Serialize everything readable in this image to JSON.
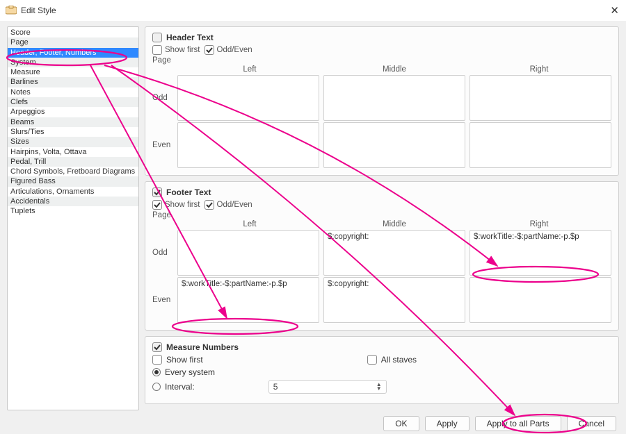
{
  "window": {
    "title": "Edit Style",
    "close_glyph": "✕"
  },
  "sidebar": {
    "items": [
      "Score",
      "Page",
      "Header, Footer, Numbers",
      "System",
      "Measure",
      "Barlines",
      "Notes",
      "Clefs",
      "Arpeggios",
      "Beams",
      "Slurs/Ties",
      "Sizes",
      "Hairpins, Volta, Ottava",
      "Pedal, Trill",
      "Chord Symbols, Fretboard Diagrams",
      "Figured Bass",
      "Articulations, Ornaments",
      "Accidentals",
      "Tuplets"
    ],
    "selected_index": 2
  },
  "header": {
    "title": "Header Text",
    "enabled": false,
    "show_first_label": "Show first",
    "show_first": false,
    "oddeven_label": "Odd/Even",
    "oddeven": true,
    "page_label": "Page",
    "cols": [
      "Left",
      "Middle",
      "Right"
    ],
    "rows": [
      "Odd",
      "Even"
    ],
    "odd": {
      "left": "",
      "middle": "",
      "right": ""
    },
    "even": {
      "left": "",
      "middle": "",
      "right": ""
    }
  },
  "footer": {
    "title": "Footer Text",
    "enabled": true,
    "show_first_label": "Show first",
    "show_first": true,
    "oddeven_label": "Odd/Even",
    "oddeven": true,
    "page_label": "Page",
    "cols": [
      "Left",
      "Middle",
      "Right"
    ],
    "rows": [
      "Odd",
      "Even"
    ],
    "odd": {
      "left": "",
      "middle": "$:copyright:",
      "right": "$:workTitle:-$:partName:-p.$p"
    },
    "even": {
      "left": "$:workTitle:-$:partName:-p.$p",
      "middle": "$:copyright:",
      "right": ""
    }
  },
  "measure_numbers": {
    "title": "Measure Numbers",
    "enabled": true,
    "show_first_label": "Show first",
    "show_first": false,
    "all_staves_label": "All staves",
    "all_staves": false,
    "every_system_label": "Every system",
    "every_system": true,
    "interval_label": "Interval:",
    "interval": false,
    "interval_value": "5"
  },
  "buttons": {
    "ok": "OK",
    "apply": "Apply",
    "apply_all": "Apply to all Parts",
    "cancel": "Cancel"
  },
  "annotations": {
    "highlight_sidebar_item": "Header, Footer, Numbers",
    "highlight_footer_odd_right": true,
    "highlight_footer_even_left": true,
    "highlight_apply_all": true,
    "arrows": [
      "sidebar-to-footer-odd-right",
      "sidebar-to-footer-even-left",
      "sidebar-to-apply-all"
    ]
  }
}
